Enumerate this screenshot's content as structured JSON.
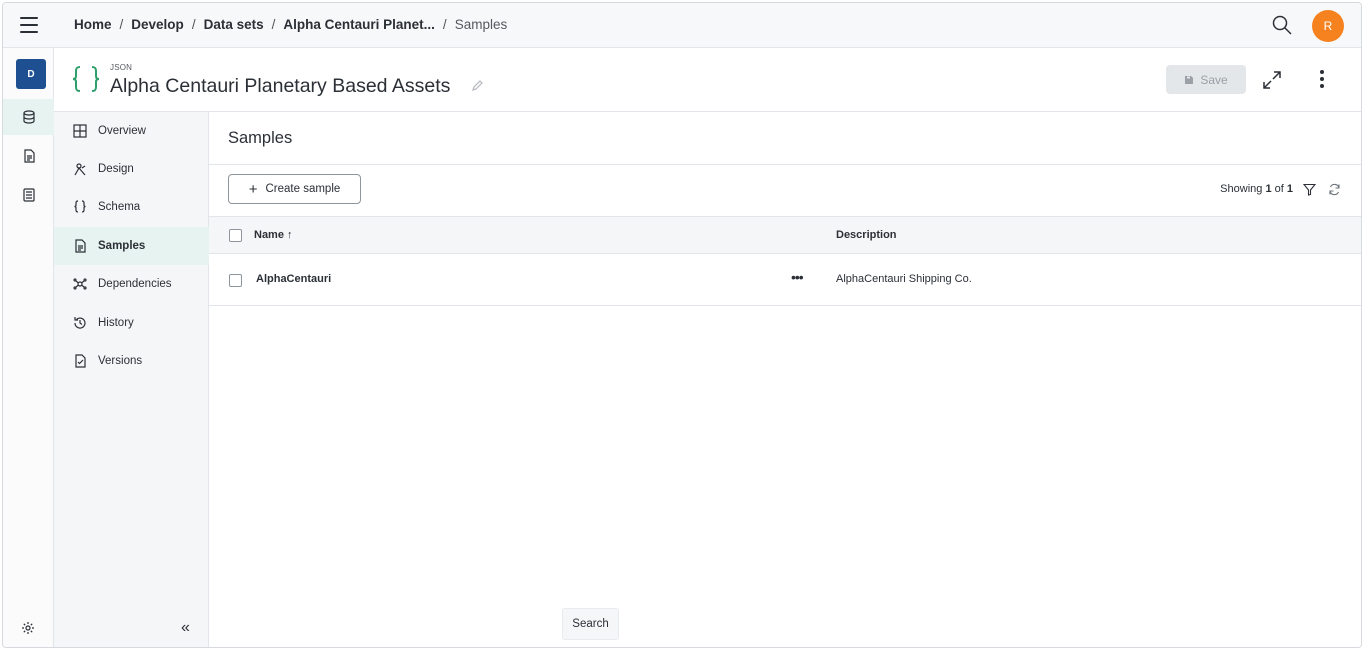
{
  "breadcrumb": [
    "Home",
    "Develop",
    "Data sets",
    "Alpha Centauri Planet...",
    "Samples"
  ],
  "rail": {
    "badge": "D"
  },
  "user": {
    "initial": "R"
  },
  "asset": {
    "type": "JSON",
    "title": "Alpha Centauri Planetary Based Assets"
  },
  "toolbar": {
    "save_label": "Save"
  },
  "nav": {
    "items": [
      {
        "label": "Overview"
      },
      {
        "label": "Design"
      },
      {
        "label": "Schema"
      },
      {
        "label": "Samples",
        "active": true
      },
      {
        "label": "Dependencies"
      },
      {
        "label": "History"
      },
      {
        "label": "Versions"
      }
    ]
  },
  "samples": {
    "title": "Samples",
    "create_label": "Create sample",
    "showing_prefix": "Showing",
    "showing_current": "1",
    "showing_of": "of",
    "showing_total": "1",
    "columns": {
      "name": "Name",
      "description": "Description"
    },
    "rows": [
      {
        "name": "AlphaCentauri",
        "description": "AlphaCentauri Shipping Co."
      }
    ]
  },
  "tooltip": {
    "search": "Search"
  },
  "colors": {
    "brand": "#1d4f91",
    "avatar": "#f5821f",
    "accent": "#2e9e6a",
    "active_bg": "#e6f3f0"
  }
}
